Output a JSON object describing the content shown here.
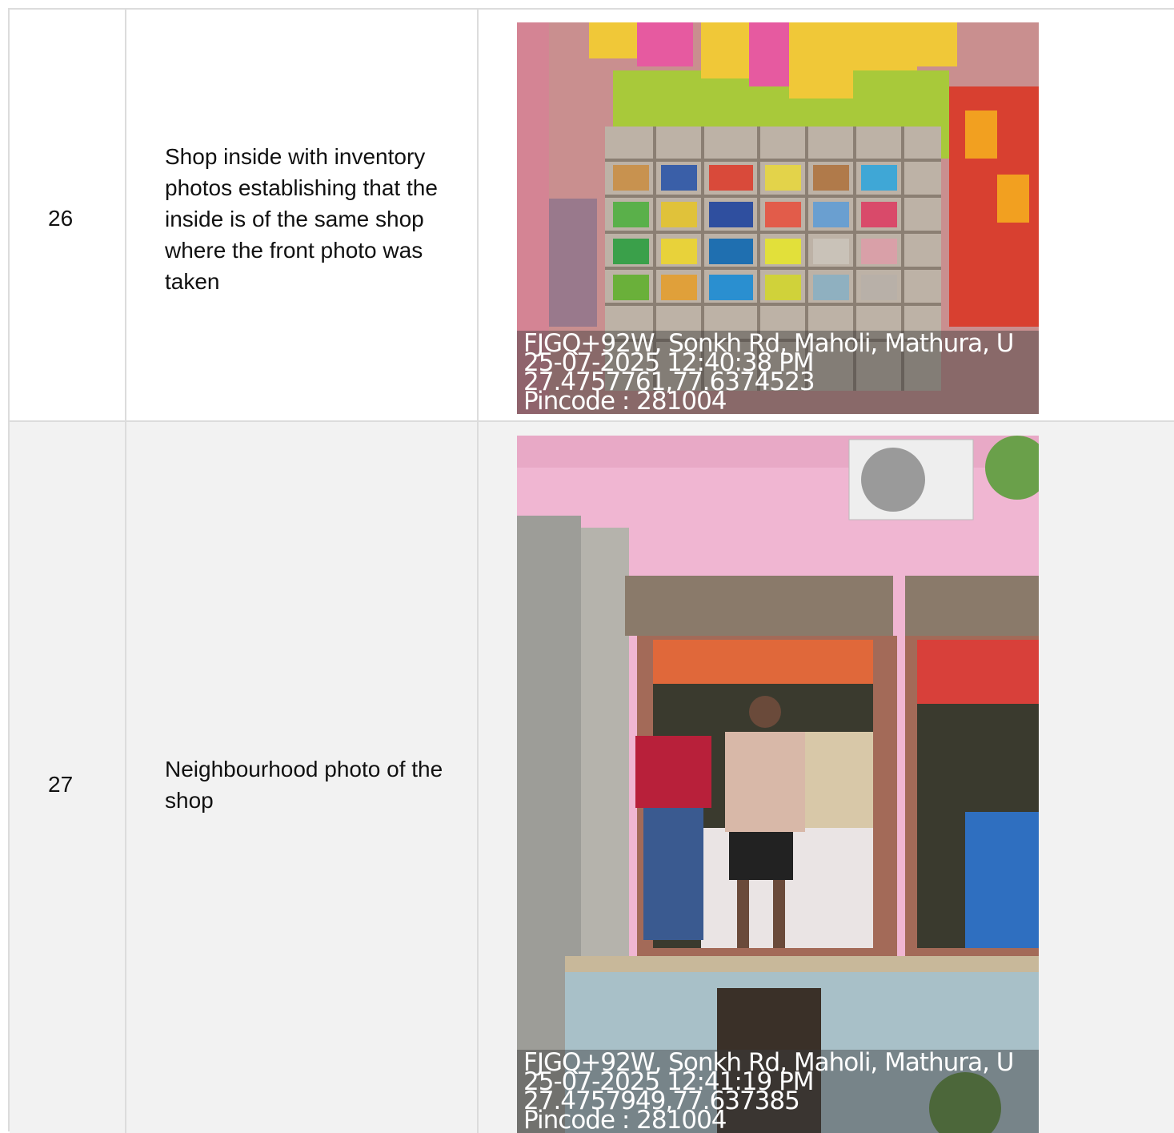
{
  "rows": [
    {
      "number": "26",
      "description": "Shop inside with inventory photos establishing that the inside is of the same shop where the front photo was taken",
      "stamp": {
        "address": "FJGQ+92W, Sonkh Rd, Maholi, Mathura, U",
        "datetime": "25-07-2025 12:40:38 PM",
        "coords": "27.4757761,77.6374523",
        "pincode": "Pincode : 281004"
      }
    },
    {
      "number": "27",
      "description": "Neighbourhood photo of the shop",
      "stamp": {
        "address": "FJGQ+92W, Sonkh Rd, Maholi, Mathura, U",
        "datetime": "25-07-2025 12:41:19 PM",
        "coords": "27.4757949,77.637385",
        "pincode": "Pincode : 281004"
      }
    }
  ]
}
